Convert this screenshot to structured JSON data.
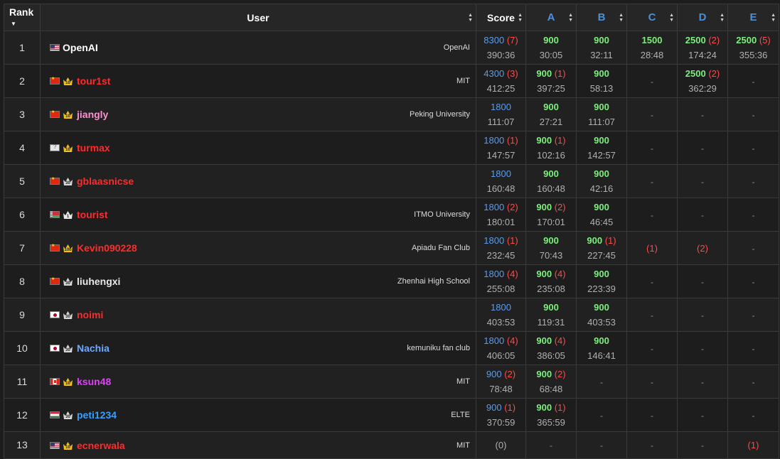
{
  "headers": {
    "rank": "Rank",
    "user": "User",
    "score": "Score",
    "problems": [
      "A",
      "B",
      "C",
      "D",
      "E"
    ]
  },
  "colors": {
    "score_points": "#5a9bf0",
    "problem_points": "#7cf07c",
    "penalty": "#ff4a4a",
    "problem_header": "#4a90d9"
  },
  "rows": [
    {
      "rank": "1",
      "flag": "flag-us",
      "crown": "",
      "user": "OpenAI",
      "user_color": "#ffffff",
      "org": "OpenAI",
      "score": {
        "pts": "8300",
        "pen": "(7)",
        "time": "390:36"
      },
      "problems": [
        {
          "pts": "900",
          "pen": "",
          "time": "30:05"
        },
        {
          "pts": "900",
          "pen": "",
          "time": "32:11"
        },
        {
          "pts": "1500",
          "pen": "",
          "time": "28:48"
        },
        {
          "pts": "2500",
          "pen": "(2)",
          "time": "174:24"
        },
        {
          "pts": "2500",
          "pen": "(5)",
          "time": "355:36"
        }
      ]
    },
    {
      "rank": "2",
      "flag": "flag-cn",
      "crown": "10",
      "user": "tour1st",
      "user_color": "#ff2b2b",
      "org": "MIT",
      "score": {
        "pts": "4300",
        "pen": "(3)",
        "time": "412:25"
      },
      "problems": [
        {
          "pts": "900",
          "pen": "(1)",
          "time": "397:25"
        },
        {
          "pts": "900",
          "pen": "",
          "time": "58:13"
        },
        {
          "dash": "-"
        },
        {
          "pts": "2500",
          "pen": "(2)",
          "time": "362:29"
        },
        {
          "dash": "-"
        }
      ]
    },
    {
      "rank": "3",
      "flag": "flag-cn",
      "crown": "10",
      "user": "jiangly",
      "user_color": "#ff8fd0",
      "org": "Peking University",
      "score": {
        "pts": "1800",
        "pen": "",
        "time": "111:07"
      },
      "problems": [
        {
          "pts": "900",
          "pen": "",
          "time": "27:21"
        },
        {
          "pts": "900",
          "pen": "",
          "time": "111:07"
        },
        {
          "dash": "-"
        },
        {
          "dash": "-"
        },
        {
          "dash": "-"
        }
      ]
    },
    {
      "rank": "4",
      "flag": "flag-unk",
      "crown": "10",
      "user": "turmax",
      "user_color": "#ff2b2b",
      "org": "",
      "score": {
        "pts": "1800",
        "pen": "(1)",
        "time": "147:57"
      },
      "problems": [
        {
          "pts": "900",
          "pen": "(1)",
          "time": "102:16"
        },
        {
          "pts": "900",
          "pen": "",
          "time": "142:57"
        },
        {
          "dash": "-"
        },
        {
          "dash": "-"
        },
        {
          "dash": "-"
        }
      ]
    },
    {
      "rank": "5",
      "flag": "flag-cn",
      "crown": "30",
      "user": "gblaasnicse",
      "user_color": "#ff2b2b",
      "org": "",
      "score": {
        "pts": "1800",
        "pen": "",
        "time": "160:48"
      },
      "problems": [
        {
          "pts": "900",
          "pen": "",
          "time": "160:48"
        },
        {
          "pts": "900",
          "pen": "",
          "time": "42:16"
        },
        {
          "dash": "-"
        },
        {
          "dash": "-"
        },
        {
          "dash": "-"
        }
      ]
    },
    {
      "rank": "6",
      "flag": "flag-by",
      "crown": "1",
      "user": "tourist",
      "user_color": "#ff2b2b",
      "org": "ITMO University",
      "score": {
        "pts": "1800",
        "pen": "(2)",
        "time": "180:01"
      },
      "problems": [
        {
          "pts": "900",
          "pen": "(2)",
          "time": "170:01"
        },
        {
          "pts": "900",
          "pen": "",
          "time": "46:45"
        },
        {
          "dash": "-"
        },
        {
          "dash": "-"
        },
        {
          "dash": "-"
        }
      ]
    },
    {
      "rank": "7",
      "flag": "flag-cn",
      "crown": "100",
      "user": "Kevin090228",
      "user_color": "#ff2b2b",
      "org": "Apiadu Fan Club",
      "score": {
        "pts": "1800",
        "pen": "(1)",
        "time": "232:45"
      },
      "problems": [
        {
          "pts": "900",
          "pen": "",
          "time": "70:43"
        },
        {
          "pts": "900",
          "pen": "(1)",
          "time": "227:45"
        },
        {
          "penonly": "(1)"
        },
        {
          "penonly": "(2)"
        },
        {
          "dash": "-"
        }
      ]
    },
    {
      "rank": "8",
      "flag": "flag-cn",
      "crown": "30",
      "user": "liuhengxi",
      "user_color": "#e8e8e8",
      "org": "Zhenhai High School",
      "score": {
        "pts": "1800",
        "pen": "(4)",
        "time": "255:08"
      },
      "problems": [
        {
          "pts": "900",
          "pen": "(4)",
          "time": "235:08"
        },
        {
          "pts": "900",
          "pen": "",
          "time": "223:39"
        },
        {
          "dash": "-"
        },
        {
          "dash": "-"
        },
        {
          "dash": "-"
        }
      ]
    },
    {
      "rank": "9",
      "flag": "flag-jp",
      "crown": "30",
      "user": "noimi",
      "user_color": "#ff2b2b",
      "org": "",
      "score": {
        "pts": "1800",
        "pen": "",
        "time": "403:53"
      },
      "problems": [
        {
          "pts": "900",
          "pen": "",
          "time": "119:31"
        },
        {
          "pts": "900",
          "pen": "",
          "time": "403:53"
        },
        {
          "dash": "-"
        },
        {
          "dash": "-"
        },
        {
          "dash": "-"
        }
      ]
    },
    {
      "rank": "10",
      "flag": "flag-jp",
      "crown": "30",
      "user": "Nachia",
      "user_color": "#6fa8ff",
      "org": "kemuniku fan club",
      "score": {
        "pts": "1800",
        "pen": "(4)",
        "time": "406:05"
      },
      "problems": [
        {
          "pts": "900",
          "pen": "(4)",
          "time": "386:05"
        },
        {
          "pts": "900",
          "pen": "",
          "time": "146:41"
        },
        {
          "dash": "-"
        },
        {
          "dash": "-"
        },
        {
          "dash": "-"
        }
      ]
    },
    {
      "rank": "11",
      "flag": "flag-ca",
      "crown": "10",
      "user": "ksun48",
      "user_color": "#e040fb",
      "org": "MIT",
      "score": {
        "pts": "900",
        "pen": "(2)",
        "time": "78:48"
      },
      "problems": [
        {
          "pts": "900",
          "pen": "(2)",
          "time": "68:48"
        },
        {
          "dash": "-"
        },
        {
          "dash": "-"
        },
        {
          "dash": "-"
        },
        {
          "dash": "-"
        }
      ]
    },
    {
      "rank": "12",
      "flag": "flag-hu",
      "crown": "30",
      "user": "peti1234",
      "user_color": "#3aa0ff",
      "org": "ELTE",
      "score": {
        "pts": "900",
        "pen": "(1)",
        "time": "370:59"
      },
      "problems": [
        {
          "pts": "900",
          "pen": "(1)",
          "time": "365:59"
        },
        {
          "dash": "-"
        },
        {
          "dash": "-"
        },
        {
          "dash": "-"
        },
        {
          "dash": "-"
        }
      ]
    },
    {
      "rank": "13",
      "flag": "flag-us",
      "crown": "10",
      "user": "ecnerwala",
      "user_color": "#ff2b2b",
      "org": "MIT",
      "score": {
        "zero": "(0)"
      },
      "problems": [
        {
          "dash": "-"
        },
        {
          "dash": "-"
        },
        {
          "dash": "-"
        },
        {
          "dash": "-"
        },
        {
          "penonly": "(1)"
        }
      ]
    }
  ]
}
